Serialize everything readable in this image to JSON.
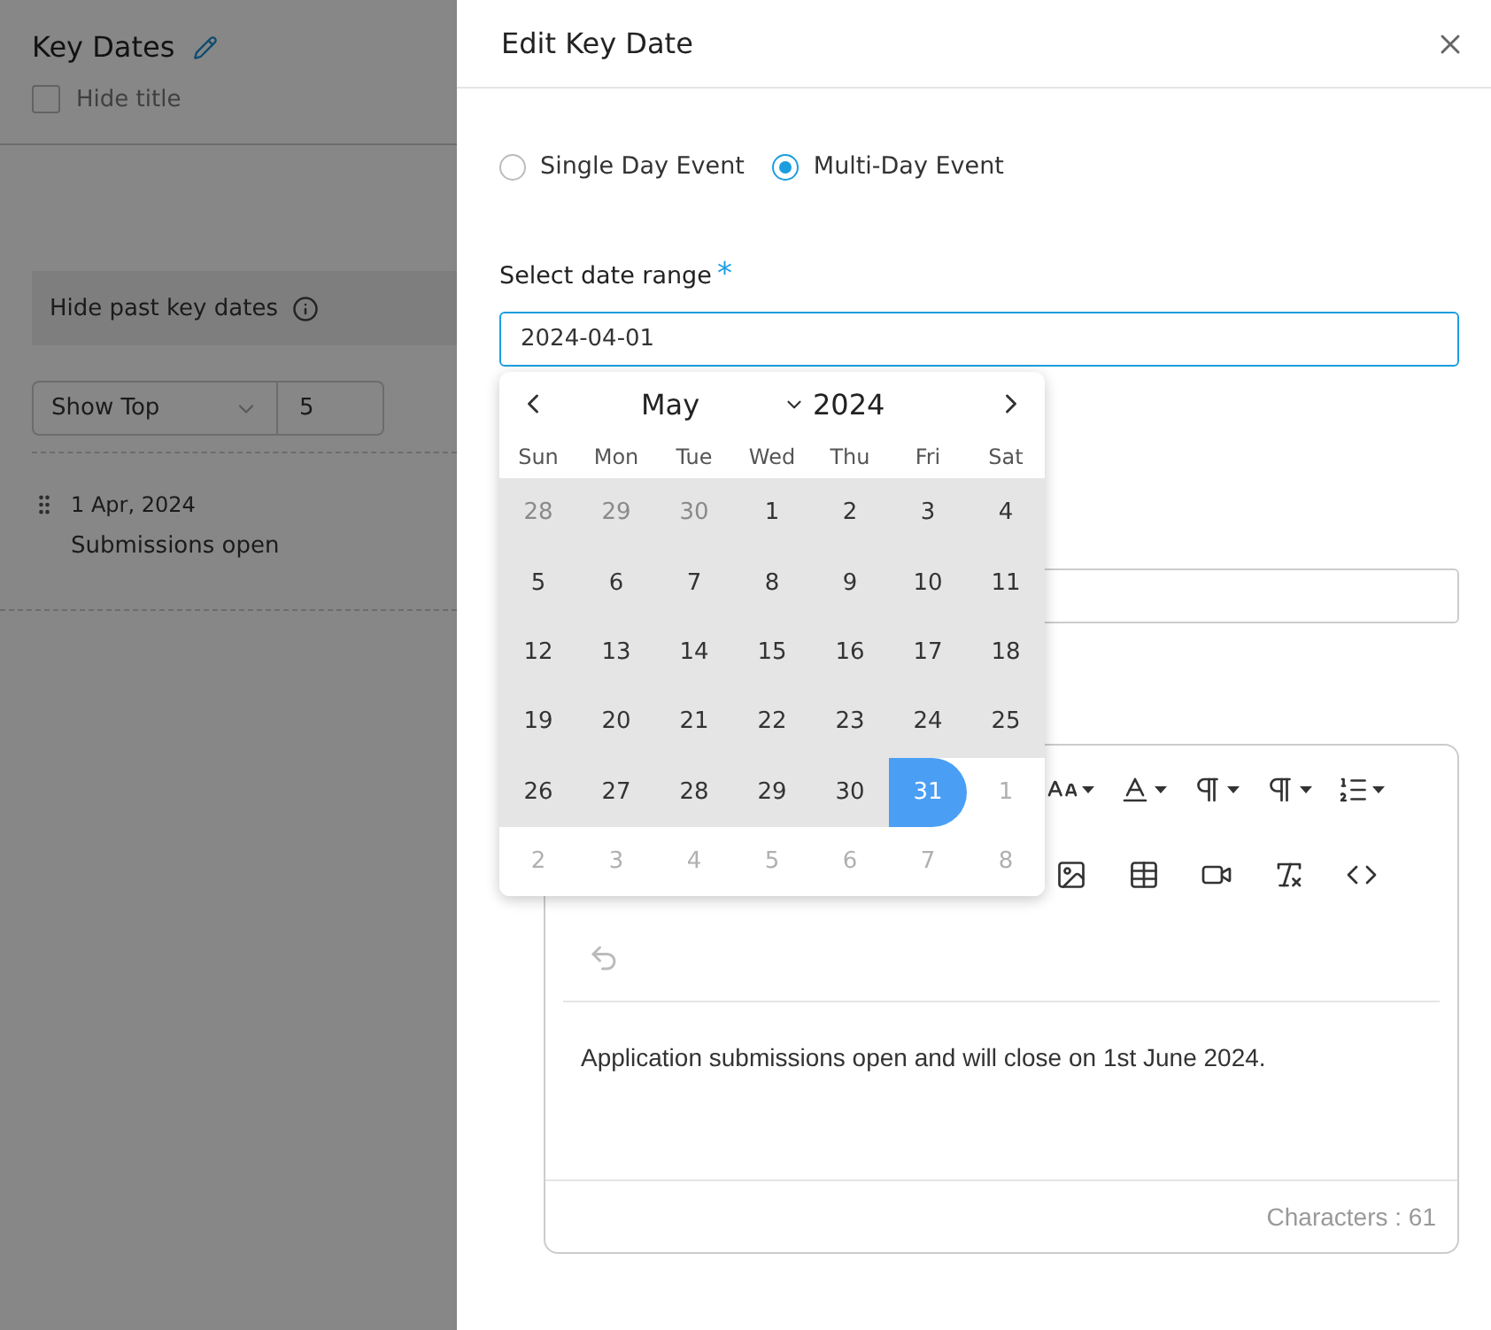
{
  "page": {
    "title": "Key Dates",
    "hide_title": {
      "label": "Hide title",
      "checked": false
    },
    "hide_past": {
      "label": "Hide past key dates"
    },
    "show_top": {
      "mode": "Show Top",
      "count": "5"
    },
    "key_dates": [
      {
        "date": "1 Apr, 2024",
        "title": "Submissions open"
      }
    ]
  },
  "drawer": {
    "title": "Edit Key Date",
    "event_types": [
      {
        "label": "Single Day Event",
        "selected": false
      },
      {
        "label": "Multi-Day Event",
        "selected": true
      }
    ],
    "date_range": {
      "label": "Select date range",
      "required_mark": "*",
      "value": "2024-04-01"
    },
    "calendar": {
      "month": "May",
      "year": "2024",
      "weekdays": [
        "Sun",
        "Mon",
        "Tue",
        "Wed",
        "Thu",
        "Fri",
        "Sat"
      ],
      "days": [
        {
          "day": "28",
          "outside": true,
          "in_range": true,
          "selected": false
        },
        {
          "day": "29",
          "outside": true,
          "in_range": true,
          "selected": false
        },
        {
          "day": "30",
          "outside": true,
          "in_range": true,
          "selected": false
        },
        {
          "day": "1",
          "outside": false,
          "in_range": true,
          "selected": false
        },
        {
          "day": "2",
          "outside": false,
          "in_range": true,
          "selected": false
        },
        {
          "day": "3",
          "outside": false,
          "in_range": true,
          "selected": false
        },
        {
          "day": "4",
          "outside": false,
          "in_range": true,
          "selected": false
        },
        {
          "day": "5",
          "outside": false,
          "in_range": true,
          "selected": false
        },
        {
          "day": "6",
          "outside": false,
          "in_range": true,
          "selected": false
        },
        {
          "day": "7",
          "outside": false,
          "in_range": true,
          "selected": false
        },
        {
          "day": "8",
          "outside": false,
          "in_range": true,
          "selected": false
        },
        {
          "day": "9",
          "outside": false,
          "in_range": true,
          "selected": false
        },
        {
          "day": "10",
          "outside": false,
          "in_range": true,
          "selected": false
        },
        {
          "day": "11",
          "outside": false,
          "in_range": true,
          "selected": false
        },
        {
          "day": "12",
          "outside": false,
          "in_range": true,
          "selected": false
        },
        {
          "day": "13",
          "outside": false,
          "in_range": true,
          "selected": false
        },
        {
          "day": "14",
          "outside": false,
          "in_range": true,
          "selected": false
        },
        {
          "day": "15",
          "outside": false,
          "in_range": true,
          "selected": false
        },
        {
          "day": "16",
          "outside": false,
          "in_range": true,
          "selected": false
        },
        {
          "day": "17",
          "outside": false,
          "in_range": true,
          "selected": false
        },
        {
          "day": "18",
          "outside": false,
          "in_range": true,
          "selected": false
        },
        {
          "day": "19",
          "outside": false,
          "in_range": true,
          "selected": false
        },
        {
          "day": "20",
          "outside": false,
          "in_range": true,
          "selected": false
        },
        {
          "day": "21",
          "outside": false,
          "in_range": true,
          "selected": false
        },
        {
          "day": "22",
          "outside": false,
          "in_range": true,
          "selected": false
        },
        {
          "day": "23",
          "outside": false,
          "in_range": true,
          "selected": false
        },
        {
          "day": "24",
          "outside": false,
          "in_range": true,
          "selected": false
        },
        {
          "day": "25",
          "outside": false,
          "in_range": true,
          "selected": false
        },
        {
          "day": "26",
          "outside": false,
          "in_range": true,
          "selected": false
        },
        {
          "day": "27",
          "outside": false,
          "in_range": true,
          "selected": false
        },
        {
          "day": "28",
          "outside": false,
          "in_range": true,
          "selected": false
        },
        {
          "day": "29",
          "outside": false,
          "in_range": true,
          "selected": false
        },
        {
          "day": "30",
          "outside": false,
          "in_range": true,
          "selected": false
        },
        {
          "day": "31",
          "outside": false,
          "in_range": false,
          "selected": true
        },
        {
          "day": "1",
          "outside": true,
          "in_range": false,
          "selected": false
        },
        {
          "day": "2",
          "outside": true,
          "in_range": false,
          "selected": false
        },
        {
          "day": "3",
          "outside": true,
          "in_range": false,
          "selected": false
        },
        {
          "day": "4",
          "outside": true,
          "in_range": false,
          "selected": false
        },
        {
          "day": "5",
          "outside": true,
          "in_range": false,
          "selected": false
        },
        {
          "day": "6",
          "outside": true,
          "in_range": false,
          "selected": false
        },
        {
          "day": "7",
          "outside": true,
          "in_range": false,
          "selected": false
        },
        {
          "day": "8",
          "outside": true,
          "in_range": false,
          "selected": false
        }
      ]
    },
    "editor": {
      "content": "Application submissions open and will close on 1st June 2024.",
      "character_count": "Characters : 61"
    }
  }
}
